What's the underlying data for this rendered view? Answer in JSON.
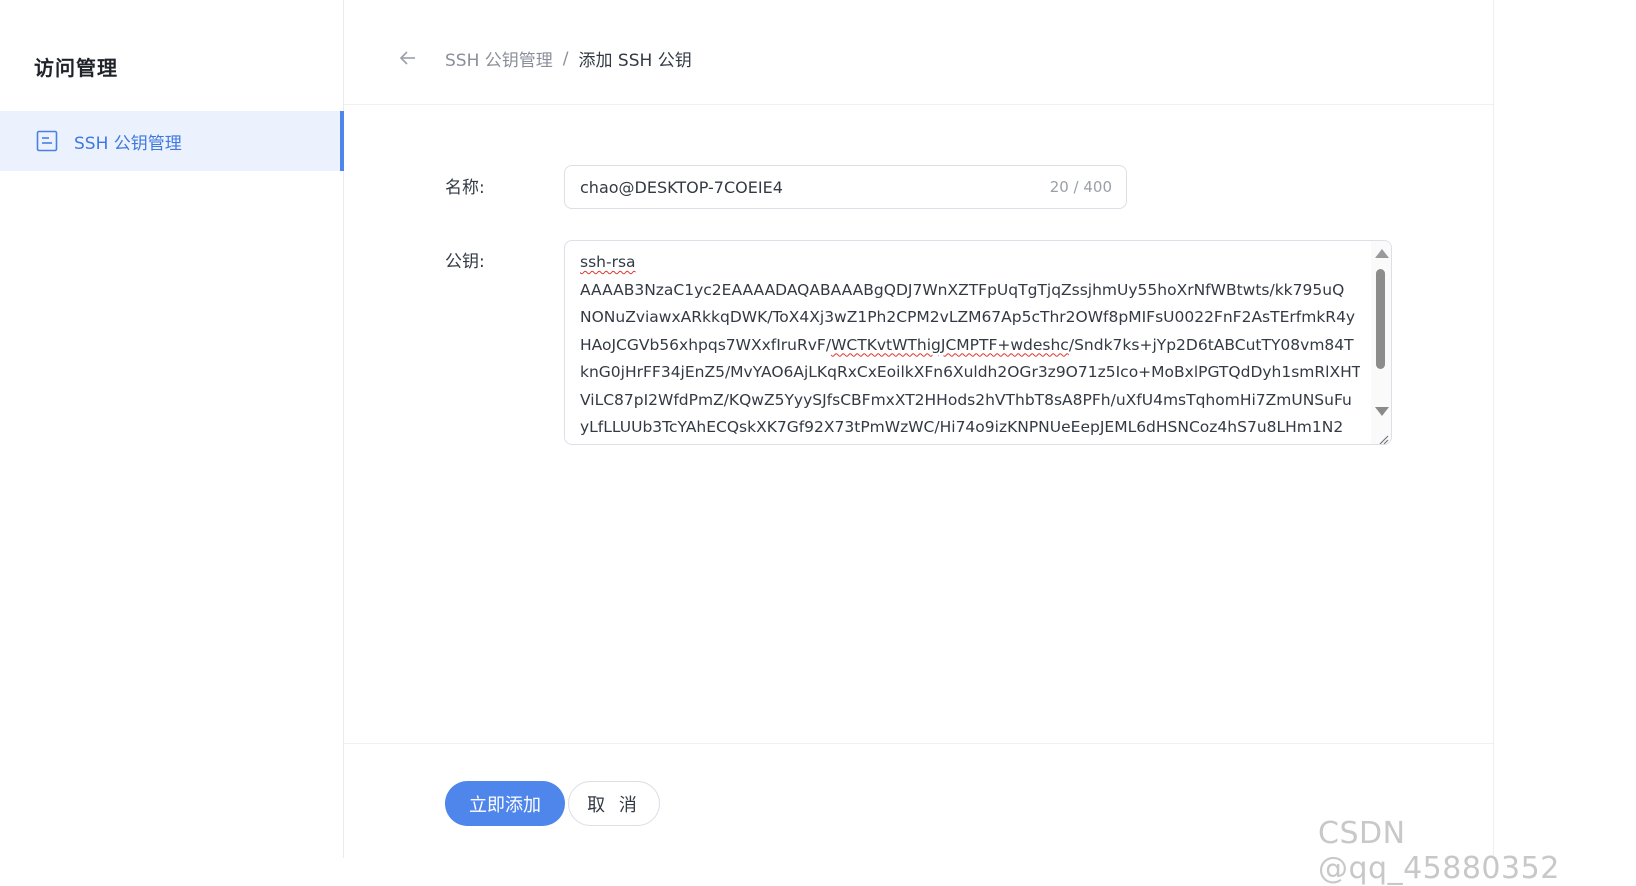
{
  "sidebar": {
    "title": "访问管理",
    "items": [
      {
        "label": "SSH 公钥管理",
        "icon": "document-list-icon",
        "active": true
      }
    ]
  },
  "breadcrumb": {
    "parent": "SSH 公钥管理",
    "separator": "/",
    "current": "添加 SSH 公钥"
  },
  "form": {
    "name_label": "名称:",
    "name_value": "chao@DESKTOP-7COEIE4",
    "name_count": "20 / 400",
    "key_label": "公钥:",
    "key_lines": [
      "ssh-rsa",
      "AAAAB3NzaC1yc2EAAAADAQABAAABgQDJ7WnXZTFpUqTgTjqZssjhmUy55hoXrNfWBtwts/kk795uQ",
      "NONuZviawxARkkqDWK/ToX4Xj3wZ1Ph2CPM2vLZM67Ap5cThr2OWf8pMIFsU0022FnF2AsTErfmkR4y",
      "HAoJCGVb56xhpqs7WXxfIruRvF/WCTKvtWThigJCMPTF+wdeshc/Sndk7ks+jYp2D6tABCutTY08vm84T",
      "knG0jHrFF34jEnZ5/MvYAO6AjLKqRxCxEoilkXFn6Xuldh2OGr3z9O71z5Ico+MoBxlPGTQdDyh1smRlXHT",
      "ViLC87pI2WfdPmZ/KQwZ5YyySJfsCBFmxXT2HHods2hVThbT8sA8PFh/uXfU4msTqhomHi7ZmUNSuFu",
      "yLfLLUUb3TcYAhECQskXK7Gf92X73tPmWzWC/Hi74o9izKNPNUeEepJEML6dHSNCoz4hS7u8LHm1N2"
    ],
    "key_line4_prefix": "HAoJCGVb56xhpqs7WXxfIruRvF/",
    "key_line4_squiggle": "WCTKvtWThigJCMPTF+wdeshc",
    "key_line4_suffix": "/Sndk7ks+jYp2D6tABCutTY08vm84T"
  },
  "actions": {
    "submit_label": "立即添加",
    "cancel_label": "取 消"
  },
  "watermark": "CSDN @qq_45880352",
  "colors": {
    "accent": "#4f86ec",
    "sidebar_active_bg": "#ebf2fd"
  }
}
